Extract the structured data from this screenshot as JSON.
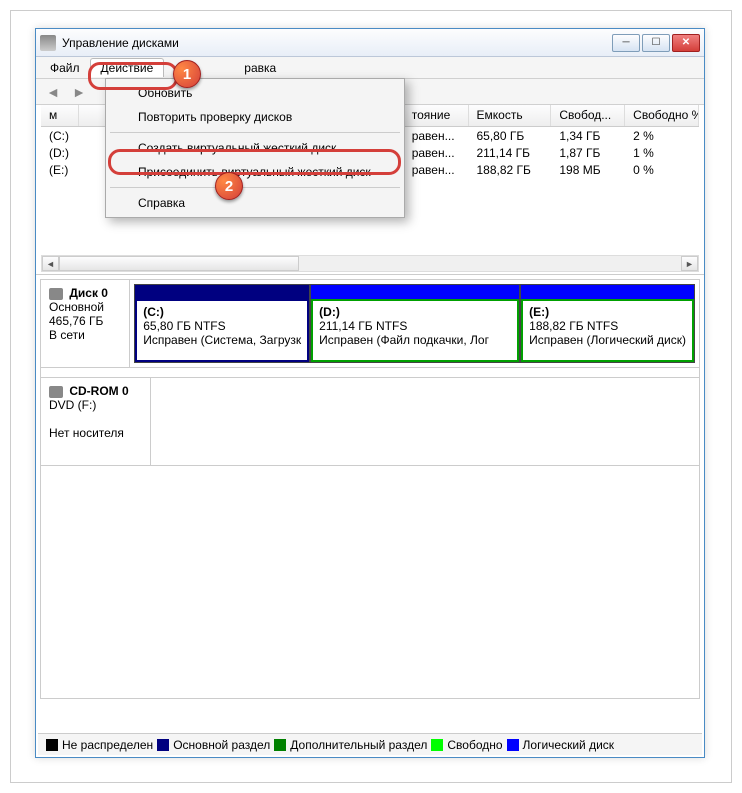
{
  "window": {
    "title": "Управление дисками"
  },
  "menu": {
    "file": "Файл",
    "action": "Действие",
    "help": "равка",
    "dropdown": {
      "refresh": "Обновить",
      "rescan": "Повторить проверку дисков",
      "create_vhd": "Создать виртуальный жесткий диск",
      "attach_vhd": "Присоединить виртуальный жесткий диск",
      "about": "Справка"
    }
  },
  "badges": {
    "one": "1",
    "two": "2"
  },
  "vol_headers": {
    "vol": "м",
    "state": "тояние",
    "cap": "Емкость",
    "free": "Свобод...",
    "pct": "Свободно %"
  },
  "volumes": [
    {
      "name": "(C:)",
      "state": "равен...",
      "cap": "65,80 ГБ",
      "free": "1,34 ГБ",
      "pct": "2 %"
    },
    {
      "name": "(D:)",
      "state": "равен...",
      "cap": "211,14 ГБ",
      "free": "1,87 ГБ",
      "pct": "1 %"
    },
    {
      "name": "(E:)",
      "state": "равен...",
      "cap": "188,82 ГБ",
      "free": "198 МБ",
      "pct": "0 %"
    }
  ],
  "disk0": {
    "name": "Диск 0",
    "type": "Основной",
    "size": "465,76 ГБ",
    "status": "В сети",
    "c": {
      "label": "(C:)",
      "info": "65,80 ГБ NTFS",
      "status": "Исправен (Система, Загрузк"
    },
    "d": {
      "label": "(D:)",
      "info": "211,14 ГБ NTFS",
      "status": "Исправен (Файл подкачки, Лог"
    },
    "e": {
      "label": "(E:)",
      "info": "188,82 ГБ NTFS",
      "status": "Исправен (Логический диск)"
    }
  },
  "cdrom": {
    "name": "CD-ROM 0",
    "sub": "DVD (F:)",
    "status": "Нет носителя"
  },
  "legend": {
    "unalloc": "Не распределен",
    "primary": "Основной раздел",
    "extended": "Дополнительный раздел",
    "free": "Свободно",
    "logical": "Логический диск"
  },
  "colors": {
    "unalloc": "#000000",
    "primary": "#000080",
    "extended": "#008000",
    "free": "#00ff00",
    "logical": "#0000ff"
  }
}
